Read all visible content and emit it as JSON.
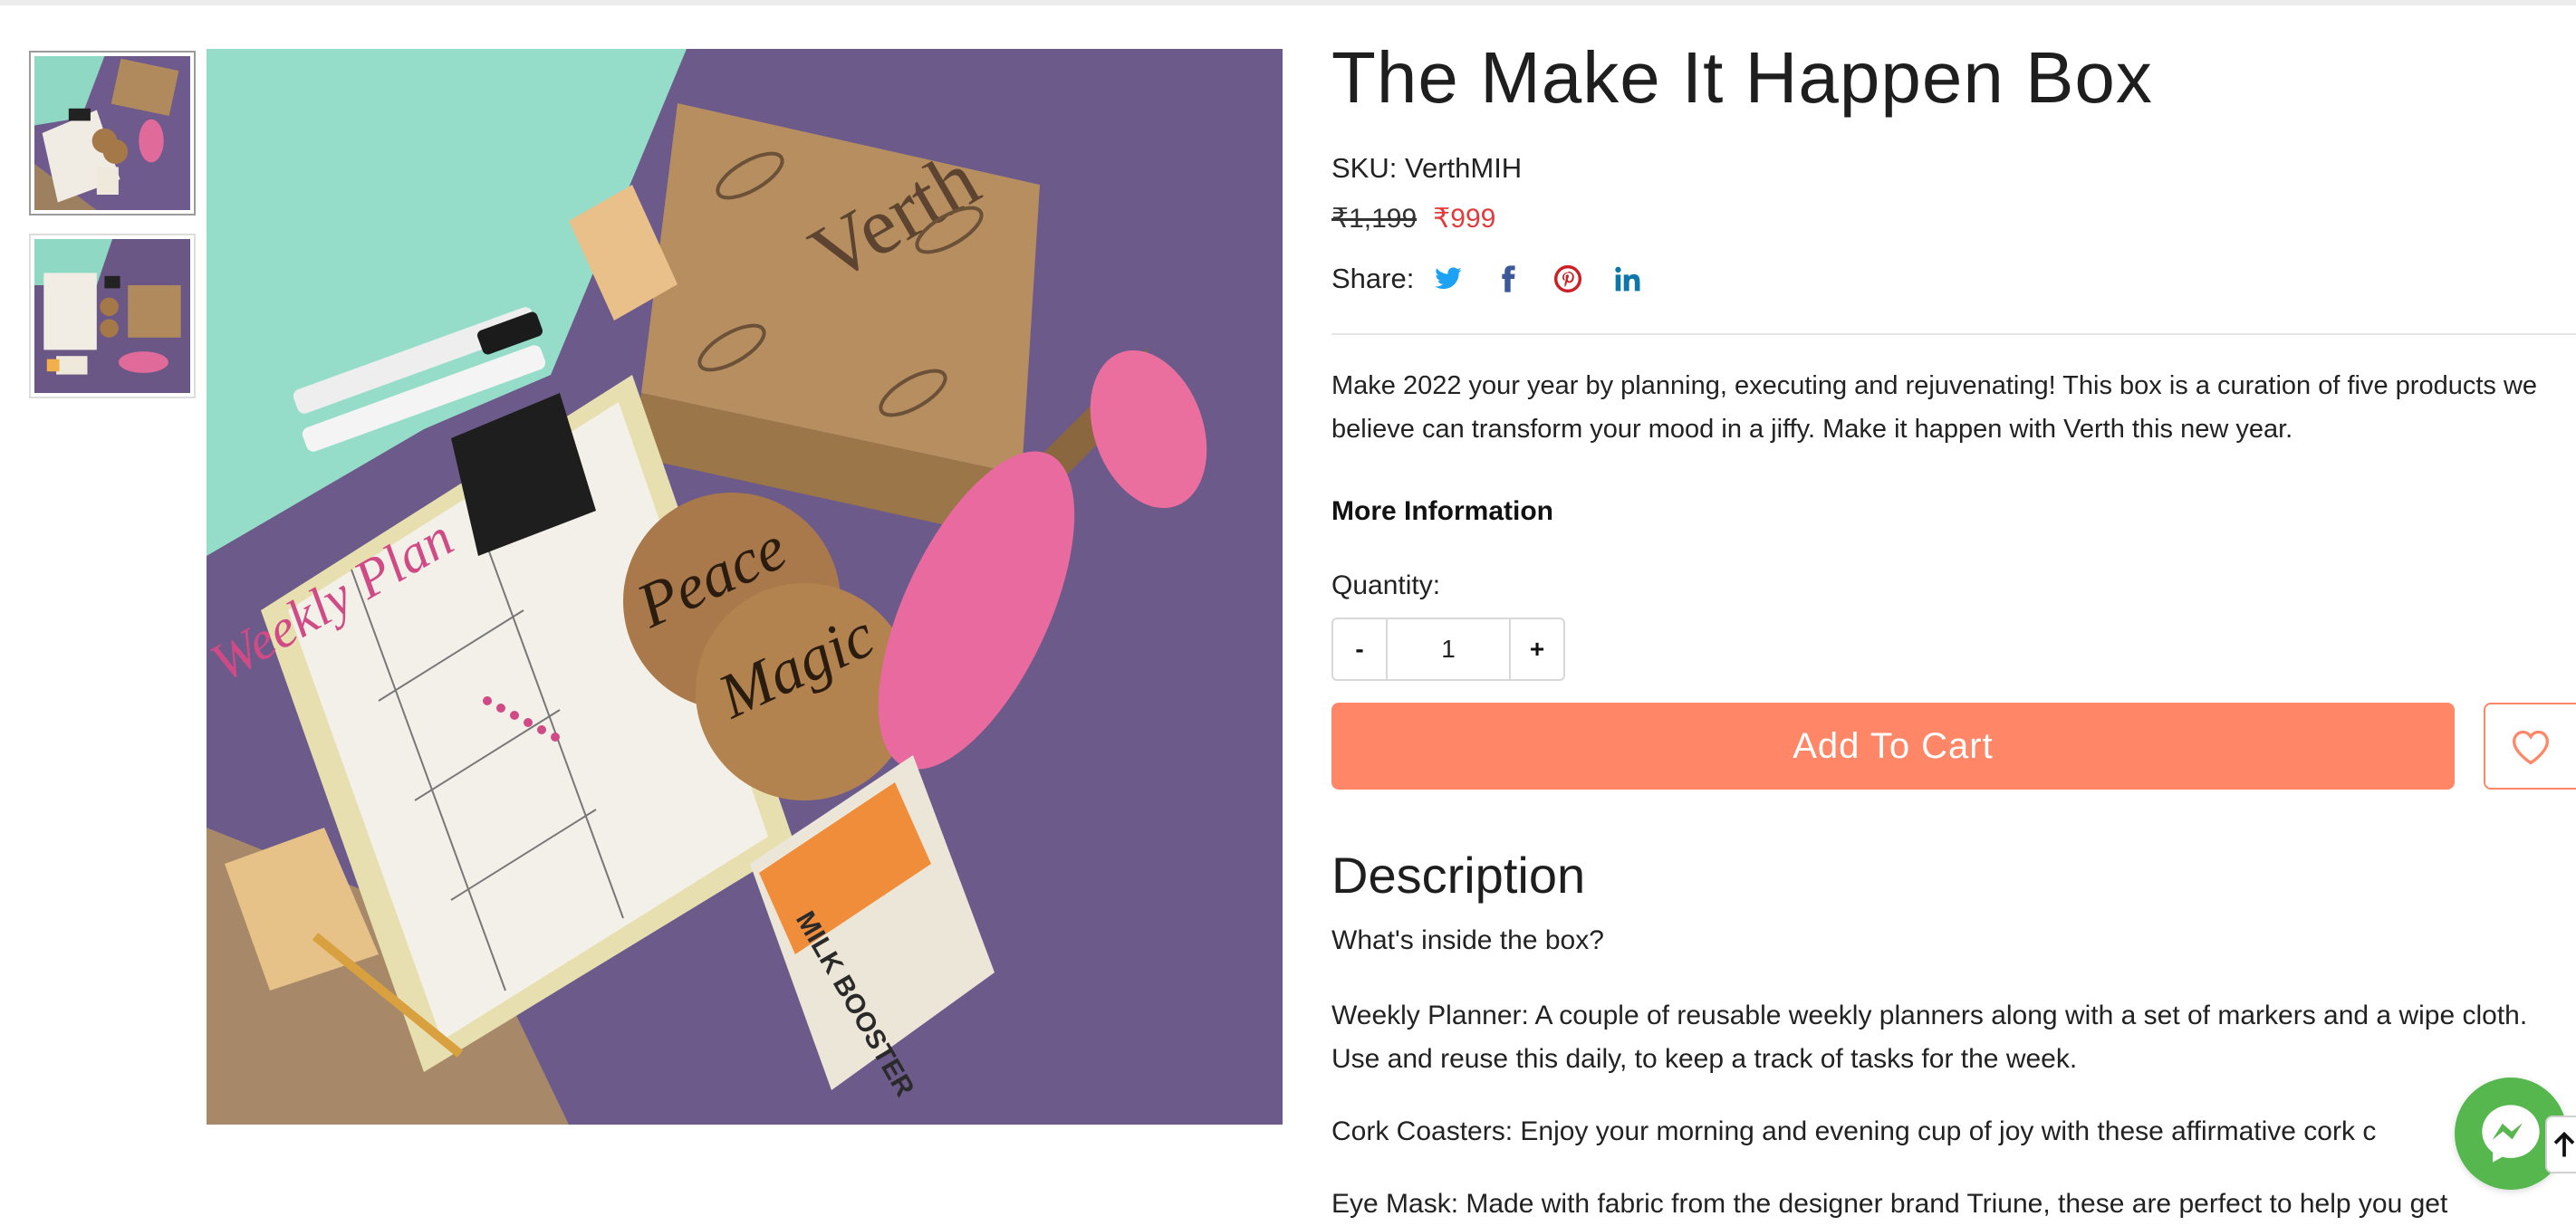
{
  "product": {
    "title": "The Make It Happen Box",
    "sku_label": "SKU:",
    "sku_value": "VerthMIH",
    "old_price": "₹1,199",
    "new_price": "₹999",
    "summary": "Make 2022 your year by planning, executing and rejuvenating! This box is a curation of five products we believe can transform your mood in a jiffy. Make it happen with Verth this new year.",
    "more_info": "More Information"
  },
  "share": {
    "label": "Share:",
    "icons": [
      "twitter-icon",
      "facebook-icon",
      "pinterest-icon",
      "linkedin-icon"
    ],
    "colors": {
      "twitter": "#1da1f2",
      "facebook": "#3b5998",
      "pinterest": "#cb2027",
      "linkedin": "#0e76a8"
    }
  },
  "quantity": {
    "label": "Quantity:",
    "minus": "-",
    "plus": "+",
    "value": "1"
  },
  "cart": {
    "add_label": "Add To Cart",
    "wishlist_icon": "heart-icon"
  },
  "description": {
    "heading": "Description",
    "subheading": "What's inside the box?",
    "p1": "Weekly Planner: A couple of reusable weekly planners along with a set of markers and a wipe cloth. Use and reuse this daily, to keep a track of tasks for the week.",
    "p2": "Cork Coasters: Enjoy your morning and evening cup of joy with these affirmative cork c",
    "p3": "Eye Mask: Made with fabric from the designer brand Triune, these are perfect to help you get"
  },
  "gallery": {
    "coaster_1": "Peace",
    "coaster_2": "Magic",
    "box_brand": "Verth",
    "pouch_label": "MILK BOOSTER",
    "planner_title": "Weekly Plan"
  },
  "colors": {
    "accent": "#ff8767",
    "sale_price": "#e23b3b",
    "messenger": "#55b74e"
  }
}
